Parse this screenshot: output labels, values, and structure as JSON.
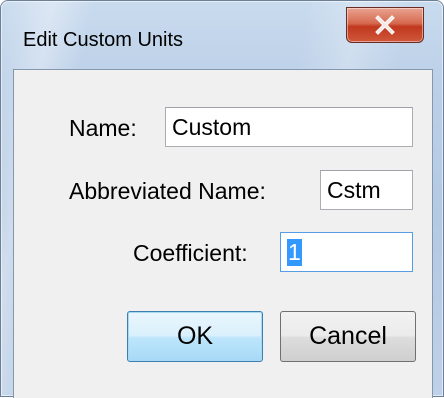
{
  "window": {
    "title": "Edit Custom Units"
  },
  "form": {
    "name_label": "Name:",
    "name_value": "Custom",
    "abbrev_label": "Abbreviated Name:",
    "abbrev_value": "Cstm",
    "coefficient_label": "Coefficient:",
    "coefficient_value": "1"
  },
  "buttons": {
    "ok_label": "OK",
    "cancel_label": "Cancel"
  },
  "icons": {
    "close": "close-icon"
  }
}
